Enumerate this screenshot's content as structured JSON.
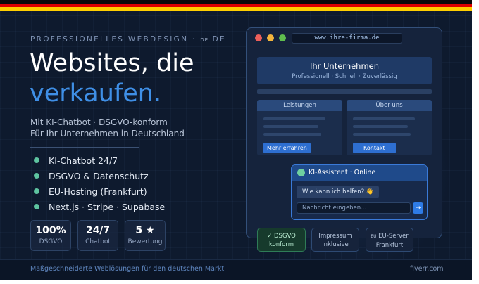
{
  "colors": {
    "flag_black": "#0a0a0a",
    "flag_red": "#dd0000",
    "flag_gold": "#ffce00",
    "accent_blue": "#3f8fe6",
    "bullet_green": "#5ec4a0"
  },
  "eyebrow": {
    "text": "PROFESSIONELLES WEBDESIGN · ",
    "flag_code": "DE",
    "suffix": "DE"
  },
  "headline": {
    "line1": "Websites, die",
    "line2": "verkaufen."
  },
  "subtitle": {
    "line1": "Mit KI-Chatbot · DSGVO-konform",
    "line2": "Für Ihr Unternehmen in Deutschland"
  },
  "features": [
    {
      "label": "KI-Chatbot 24/7"
    },
    {
      "label": "DSGVO & Datenschutz"
    },
    {
      "label": "EU-Hosting (Frankfurt)"
    },
    {
      "label": "Next.js · Stripe · Supabase"
    }
  ],
  "stats": [
    {
      "value": "100%",
      "label": "DSGVO"
    },
    {
      "value": "24/7",
      "label": "Chatbot"
    },
    {
      "value": "5 ★",
      "label": "Bewertung"
    }
  ],
  "browser": {
    "url": "www.ihre-firma.de",
    "hero_title": "Ihr Unternehmen",
    "hero_subtitle": "Professionell · Schnell · Zuverlässig",
    "card1": {
      "title": "Leistungen",
      "button": "Mehr erfahren"
    },
    "card2": {
      "title": "Über uns",
      "button": "Kontakt"
    }
  },
  "chat": {
    "title": "KI-Assistent · Online",
    "message": "Wie kann ich helfen? 👋",
    "placeholder": "Nachricht eingeben...",
    "send_icon": "→"
  },
  "badges": [
    {
      "line1": "✓ DSGVO",
      "line2": "konform"
    },
    {
      "line1": "Impressum",
      "line2": "inklusive"
    },
    {
      "prefix": "EU",
      "line1": " EU-Server",
      "line2": "Frankfurt"
    }
  ],
  "footer": {
    "left": "Maßgeschneiderte Weblösungen für den deutschen Markt",
    "right": "fiverr.com"
  }
}
